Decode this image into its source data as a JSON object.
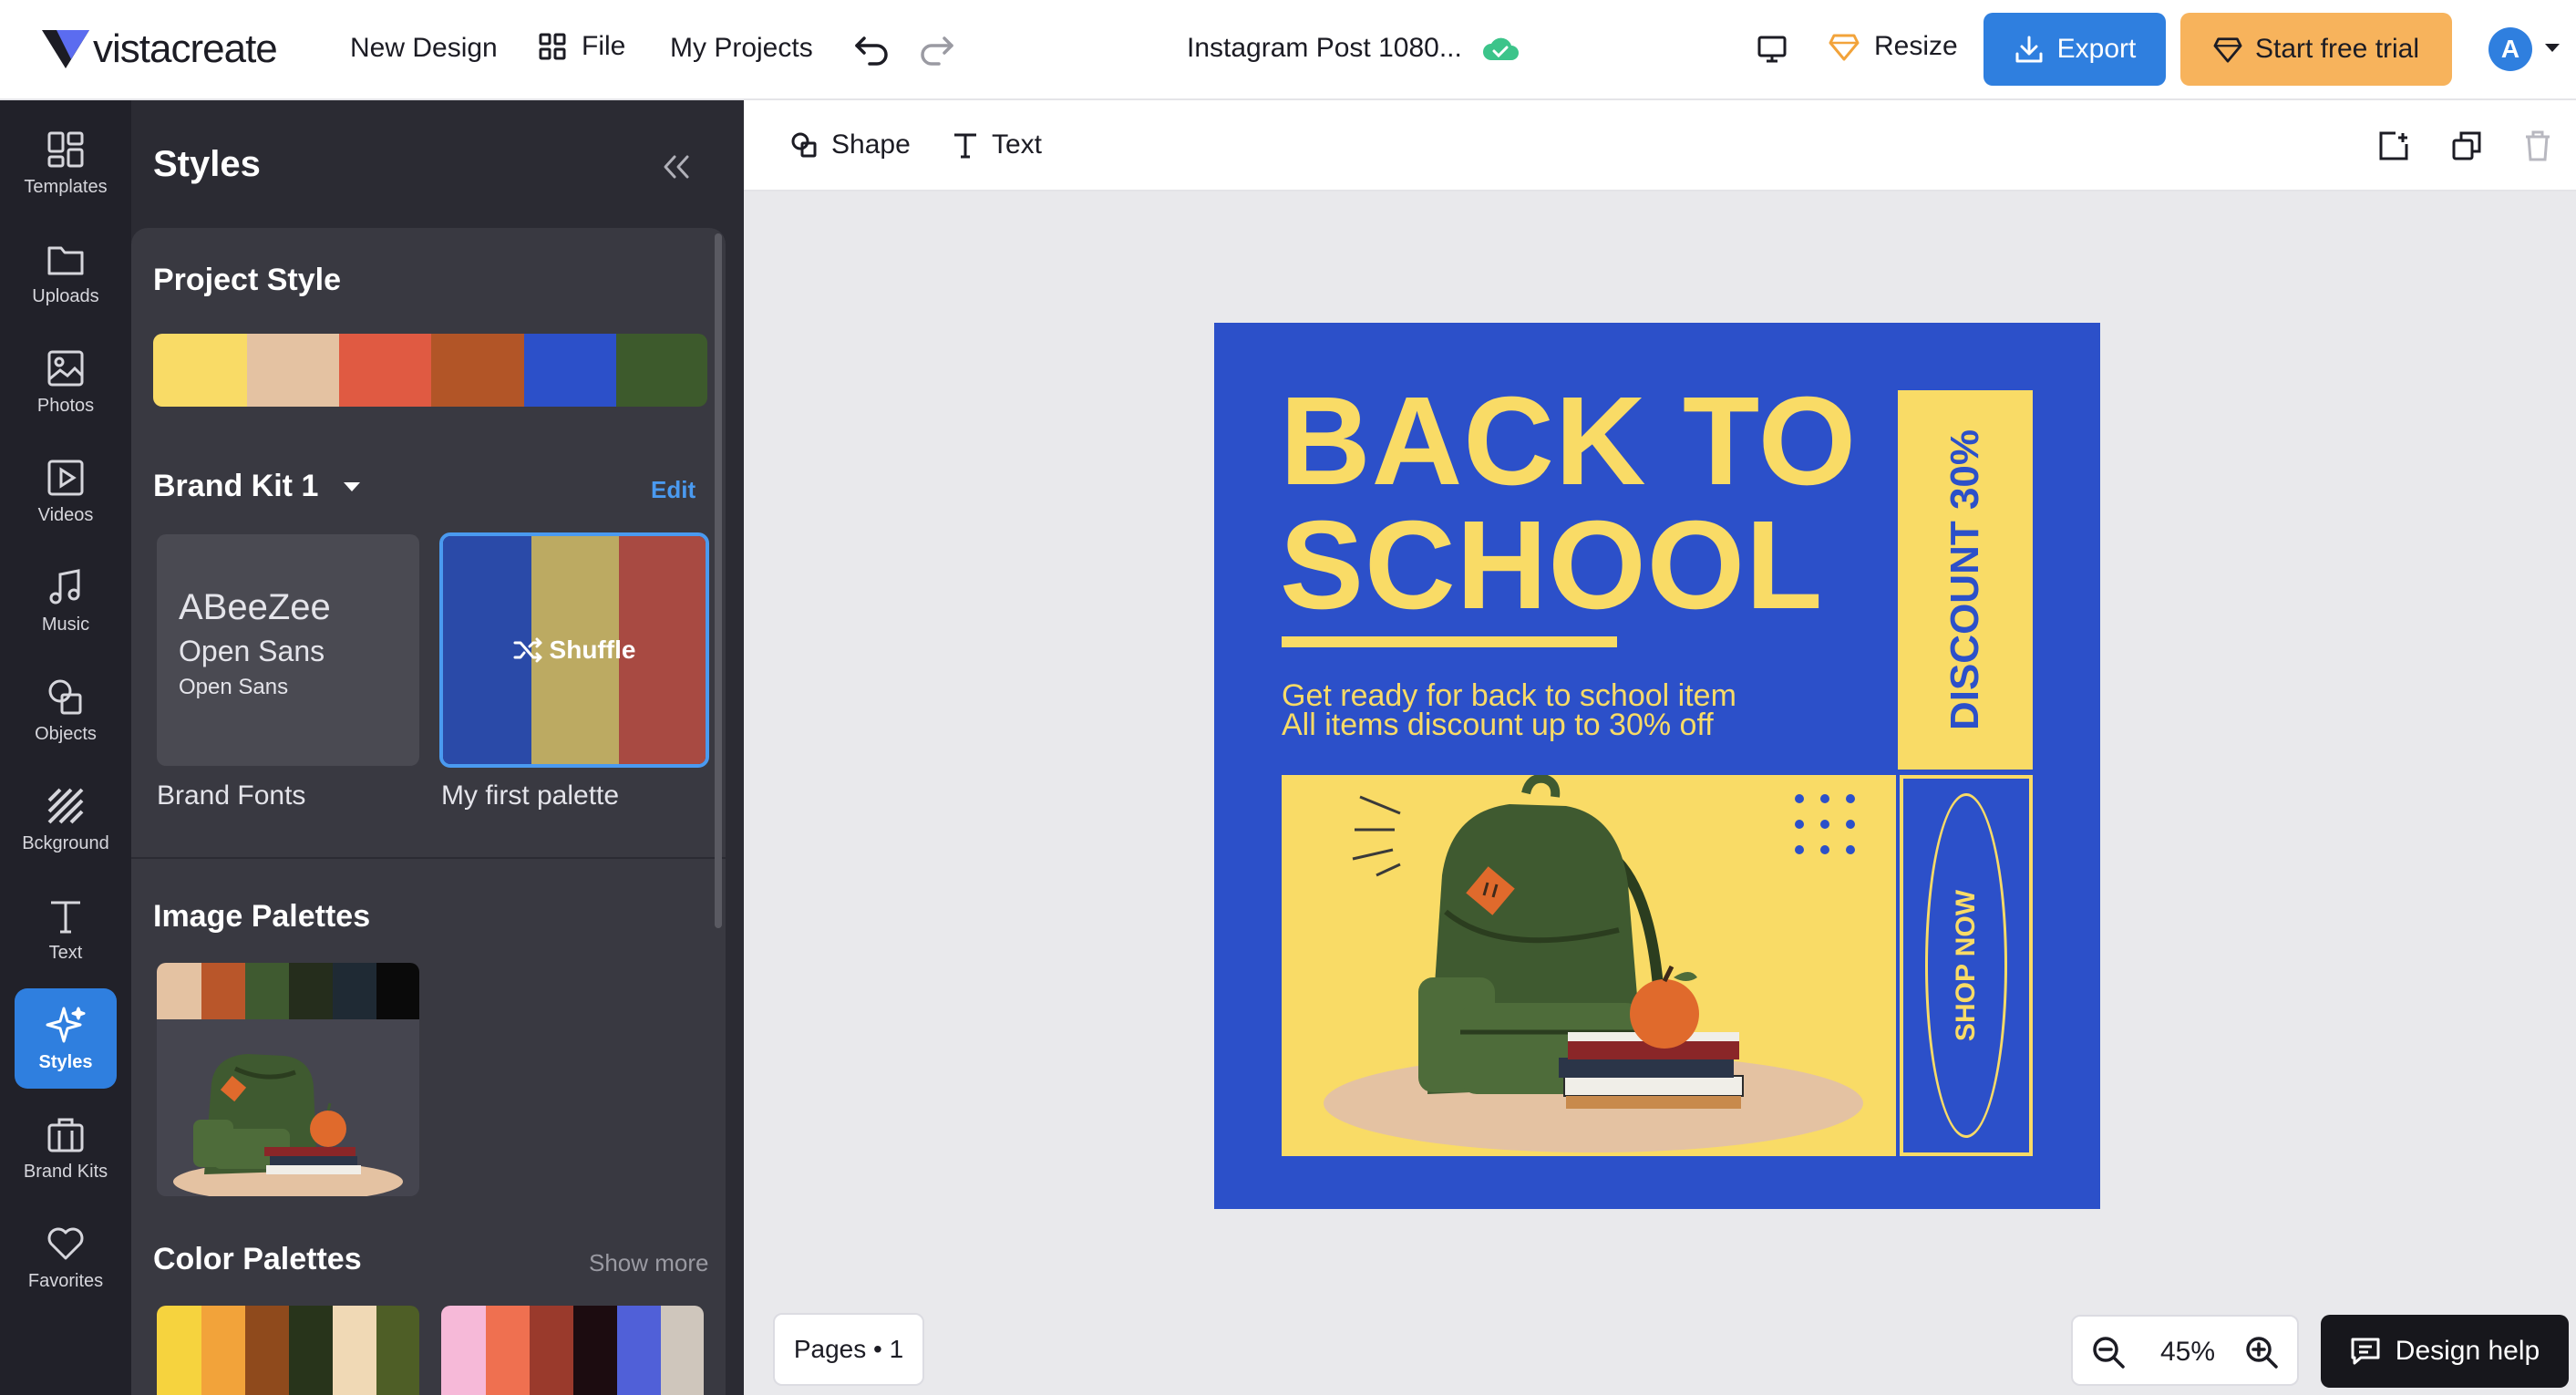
{
  "topbar": {
    "logo_text": "vistacreate",
    "new_design": "New Design",
    "file": "File",
    "my_projects": "My Projects",
    "doc_title": "Instagram Post 1080...",
    "resize": "Resize",
    "export": "Export",
    "trial": "Start free trial",
    "avatar_letter": "A"
  },
  "rail": {
    "items": [
      {
        "label": "Templates",
        "icon": "templates-icon"
      },
      {
        "label": "Uploads",
        "icon": "folder-icon"
      },
      {
        "label": "Photos",
        "icon": "image-icon"
      },
      {
        "label": "Videos",
        "icon": "play-icon"
      },
      {
        "label": "Music",
        "icon": "music-icon"
      },
      {
        "label": "Objects",
        "icon": "shapes-icon"
      },
      {
        "label": "Bckground",
        "icon": "background-icon"
      },
      {
        "label": "Text",
        "icon": "text-icon"
      },
      {
        "label": "Styles",
        "icon": "sparkle-icon"
      },
      {
        "label": "Brand Kits",
        "icon": "briefcase-icon"
      },
      {
        "label": "Favorites",
        "icon": "heart-icon"
      }
    ],
    "active": "Styles"
  },
  "panel": {
    "title": "Styles",
    "project_style": {
      "title": "Project Style",
      "colors": [
        "#f9db66",
        "#e4c2a2",
        "#e05a42",
        "#b25527",
        "#2c50c9",
        "#3d5a2c"
      ]
    },
    "brand_kit": {
      "title": "Brand Kit 1",
      "edit": "Edit",
      "fonts": [
        "ABeeZee",
        "Open Sans",
        "Open Sans"
      ],
      "fonts_caption": "Brand Fonts",
      "palette_colors": [
        "#2a4aa8",
        "#bcaa62",
        "#a84a42"
      ],
      "shuffle": "Shuffle",
      "palette_caption": "My first palette"
    },
    "image_palettes": {
      "title": "Image Palettes",
      "colors": [
        "#e4c2a2",
        "#b9562a",
        "#3f5a30",
        "#252d1c",
        "#1f2a34",
        "#0a0a0a"
      ]
    },
    "color_palettes": {
      "title": "Color Palettes",
      "show_more": "Show more",
      "palette1": [
        "#f6d33e",
        "#f2a33a",
        "#8f4a1c",
        "#28341b",
        "#f0d9b5",
        "#4e5e26"
      ],
      "palette2": [
        "#f6b9d8",
        "#ef7050",
        "#9a3a2c",
        "#1c0c10",
        "#5060d8",
        "#cfc6bc"
      ]
    }
  },
  "canvas_toolbar": {
    "shape": "Shape",
    "text": "Text"
  },
  "design": {
    "headline_1": "BACK TO",
    "headline_2": "SCHOOL",
    "line_1": "Get ready for back to school item",
    "line_2": "All items discount up to 30% off",
    "discount": "DISCOUNT 30%",
    "shop_now": "SHOP NOW",
    "colors": {
      "blue": "#2c50c9",
      "yellow": "#f9db66"
    }
  },
  "footer": {
    "pages": "Pages • 1",
    "zoom": "45%",
    "help": "Design help"
  }
}
